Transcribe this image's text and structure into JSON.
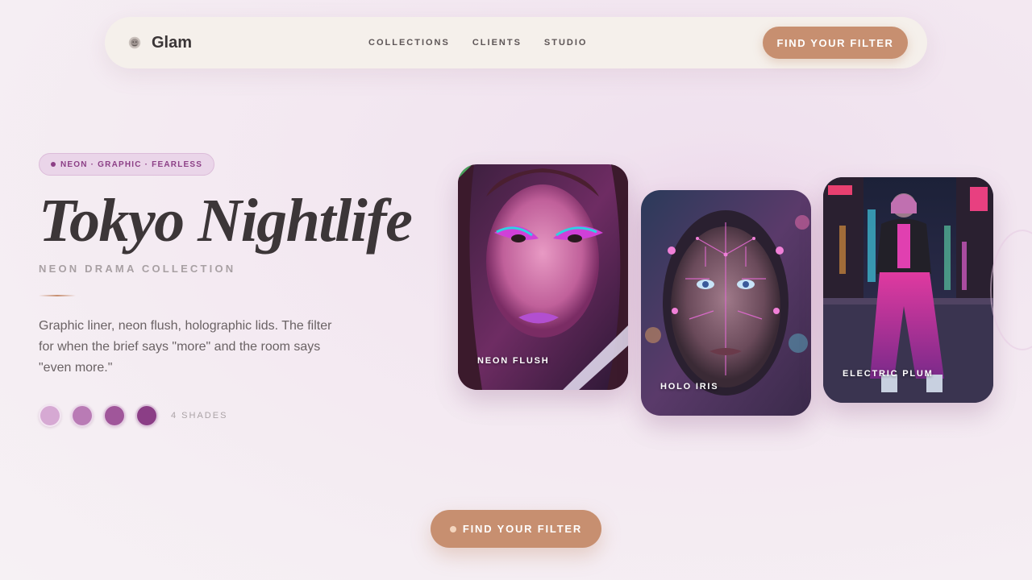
{
  "brand": {
    "name": "Glam",
    "logo_icon": "lion-crest-icon"
  },
  "nav": {
    "links": [
      "COLLECTIONS",
      "CLIENTS",
      "STUDIO"
    ],
    "cta_label": "FIND YOUR FILTER"
  },
  "hero": {
    "tag": "NEON · GRAPHIC · FEARLESS",
    "title": "Tokyo Nightlife",
    "subtitle": "NEON DRAMA COLLECTION",
    "description": "Graphic liner, neon flush, holographic lids. The filter for when the brief says \"more\" and the room says \"even more.\"",
    "swatches": [
      "#d6a9d3",
      "#b97bb5",
      "#a0569a",
      "#8b3e86"
    ],
    "shades_label": "4 SHADES"
  },
  "cards": [
    {
      "label": "NEON FLUSH"
    },
    {
      "label": "HOLO IRIS"
    },
    {
      "label": "ELECTRIC PLUM"
    }
  ],
  "bottom_cta": {
    "label": "FIND YOUR FILTER"
  },
  "colors": {
    "accent": "#c78f70",
    "brand_plum": "#8c3f86",
    "text": "#3a3536"
  }
}
